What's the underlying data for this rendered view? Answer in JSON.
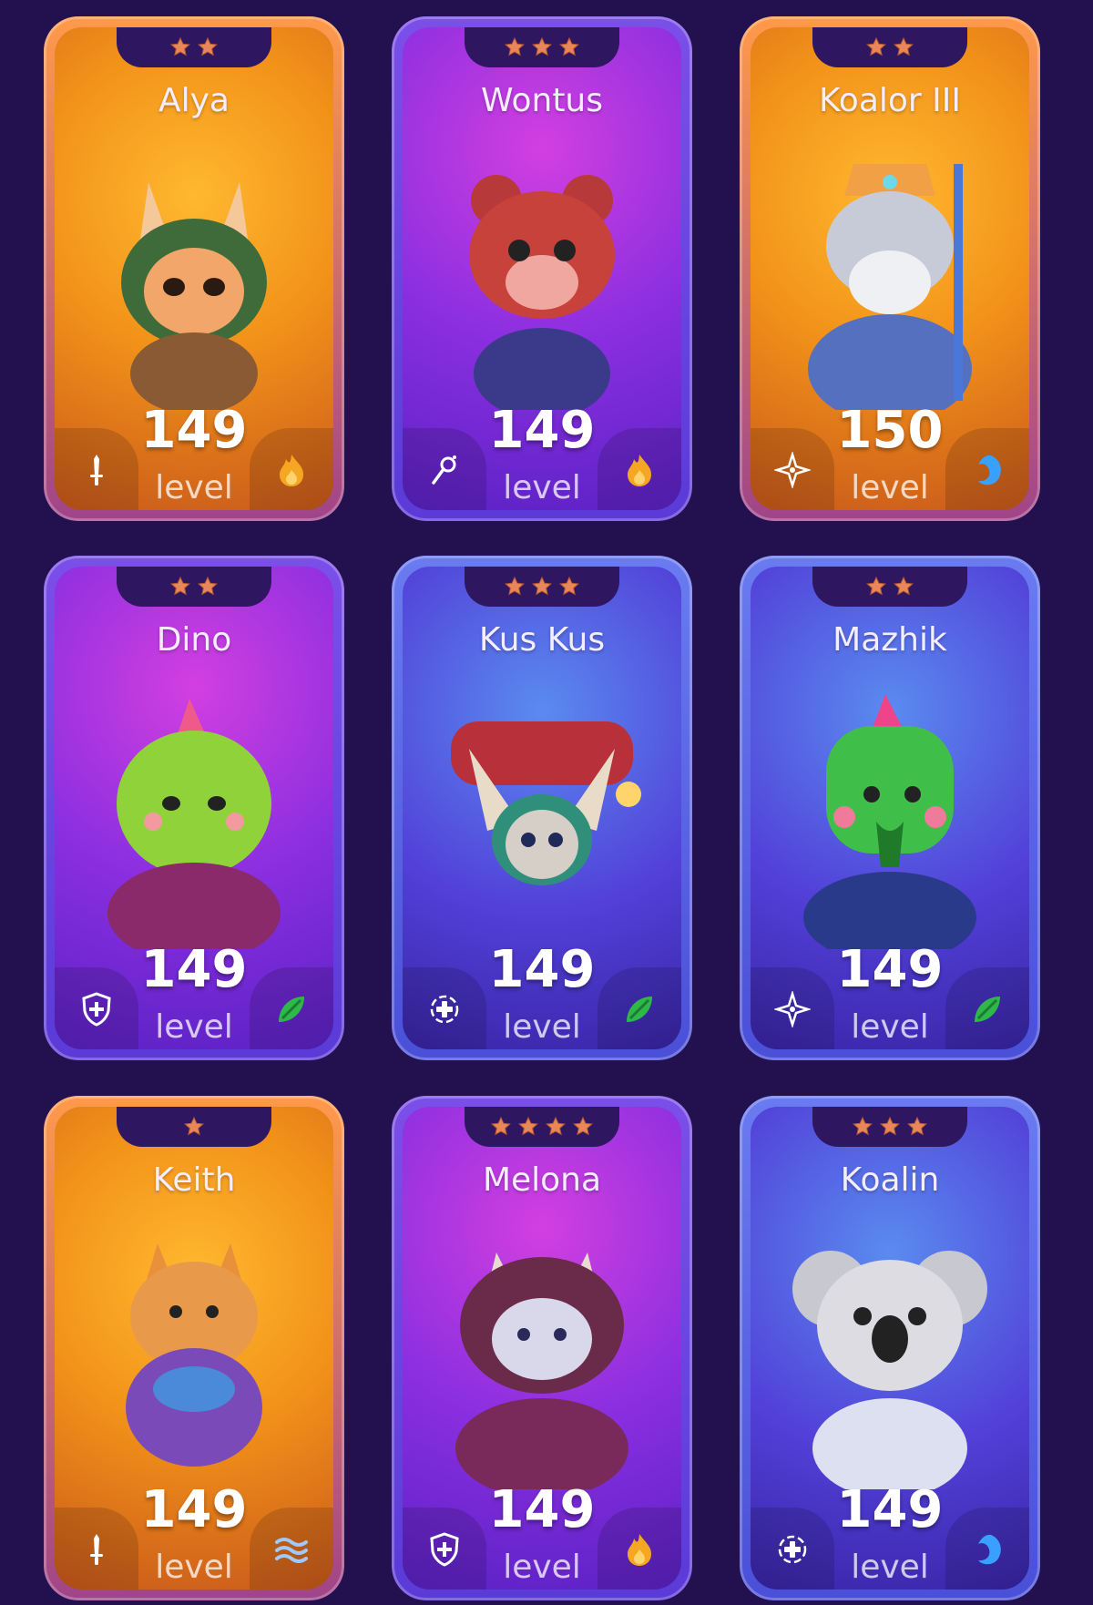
{
  "level_word": "level",
  "colors": {
    "background": "#23114f",
    "orange": "#f29219",
    "purple": "#8b2fe0",
    "blue": "#5240d8",
    "star": "#e8885a"
  },
  "cards": [
    {
      "name": "Alya",
      "level": "149",
      "stars": 2,
      "theme": "orange",
      "class_icon": "sword-icon",
      "element_icon": "fire-icon"
    },
    {
      "name": "Wontus",
      "level": "149",
      "stars": 3,
      "theme": "purple",
      "class_icon": "magic-staff-icon",
      "element_icon": "fire-icon"
    },
    {
      "name": "Koalor III",
      "level": "150",
      "stars": 2,
      "theme": "orange",
      "class_icon": "support-compass-icon",
      "element_icon": "water-icon"
    },
    {
      "name": "Dino",
      "level": "149",
      "stars": 2,
      "theme": "purple",
      "class_icon": "shield-icon",
      "element_icon": "nature-leaf-icon"
    },
    {
      "name": "Kus Kus",
      "level": "149",
      "stars": 3,
      "theme": "blue",
      "class_icon": "healer-cross-icon",
      "element_icon": "nature-leaf-icon"
    },
    {
      "name": "Mazhik",
      "level": "149",
      "stars": 2,
      "theme": "blue",
      "class_icon": "support-compass-icon",
      "element_icon": "nature-leaf-icon"
    },
    {
      "name": "Keith",
      "level": "149",
      "stars": 1,
      "theme": "orange",
      "class_icon": "sword-icon",
      "element_icon": "wind-icon"
    },
    {
      "name": "Melona",
      "level": "149",
      "stars": 4,
      "theme": "purple",
      "class_icon": "shield-icon",
      "element_icon": "fire-icon"
    },
    {
      "name": "Koalin",
      "level": "149",
      "stars": 3,
      "theme": "blue",
      "class_icon": "healer-cross-icon",
      "element_icon": "water-icon"
    }
  ]
}
